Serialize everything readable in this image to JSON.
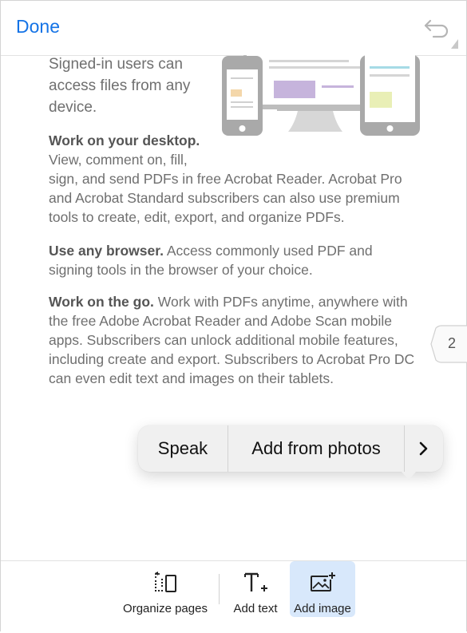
{
  "header": {
    "done_label": "Done"
  },
  "content": {
    "intro": "Signed-in users can access files from any device.",
    "desktop": {
      "heading": "Work on your desktop.",
      "line1": "View, comment on, fill,",
      "body": "sign, and send PDFs in free Acrobat Reader. Acrobat Pro and Acrobat Standard subscribers can also use premium tools to create, edit, export, and organize PDFs."
    },
    "browser": {
      "heading": "Use any browser.",
      "body": " Access commonly used PDF and signing tools in the browser of your choice."
    },
    "go": {
      "heading": "Work on the go.",
      "body": " Work with PDFs anytime, anywhere with the free Adobe Acrobat Reader and Adobe Scan mobile apps. Subscribers can unlock additional mobile features, including create and export. Subscribers to Acrobat Pro DC can even edit text and images on their tablets."
    }
  },
  "page_indicator": "2",
  "context_menu": {
    "speak": "Speak",
    "add_from_photos": "Add from photos",
    "more": "›"
  },
  "toolbar": {
    "organize_pages": "Organize pages",
    "add_text": "Add text",
    "add_image": "Add image",
    "active": "add_image",
    "active_color": "#d8e8fb"
  },
  "colors": {
    "accent": "#1473e6",
    "body_text": "#6f6f6f"
  }
}
